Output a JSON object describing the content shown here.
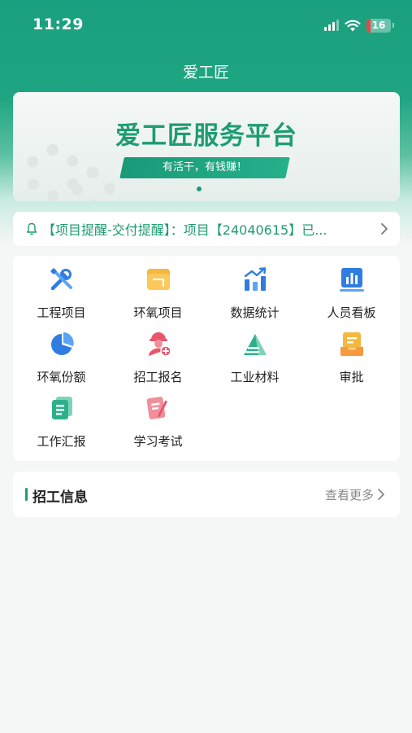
{
  "status_bar": {
    "time": "11:29",
    "battery": "16",
    "battery_level": 0.16,
    "icons": [
      "signal-icon",
      "wifi-icon",
      "battery-icon"
    ]
  },
  "nav": {
    "title": "爱工匠"
  },
  "banner": {
    "title": "爱工匠服务平台",
    "slogan": "有活干，有钱赚！",
    "accent_color": "#1e9c72"
  },
  "notice": {
    "text": "【项目提醒-交付提醒】：项目【24040615】已...",
    "icon": "bell-icon"
  },
  "menu": {
    "items": [
      {
        "label": "工程项目",
        "icon": "tools-icon"
      },
      {
        "label": "环氧项目",
        "icon": "folder-icon"
      },
      {
        "label": "数据统计",
        "icon": "bar-chart-icon"
      },
      {
        "label": "人员看板",
        "icon": "board-chart-icon"
      },
      {
        "label": "环氧份额",
        "icon": "pie-chart-icon"
      },
      {
        "label": "招工报名",
        "icon": "worker-helmet-icon"
      },
      {
        "label": "工业材料",
        "icon": "materials-icon"
      },
      {
        "label": "审批",
        "icon": "approval-icon"
      },
      {
        "label": "工作汇报",
        "icon": "report-icon"
      },
      {
        "label": "学习考试",
        "icon": "exam-icon"
      }
    ]
  },
  "recruit": {
    "title": "招工信息",
    "more_label": "查看更多"
  }
}
